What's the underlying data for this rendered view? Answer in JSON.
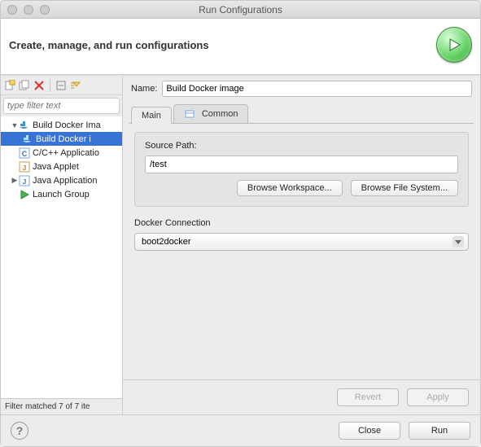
{
  "window": {
    "title": "Run Configurations"
  },
  "header": {
    "title": "Create, manage, and run configurations"
  },
  "filter": {
    "placeholder": "type filter text"
  },
  "tree": {
    "items": [
      {
        "label": "Build Docker Ima"
      },
      {
        "label": "Build Docker i"
      },
      {
        "label": "C/C++ Applicatio"
      },
      {
        "label": "Java Applet"
      },
      {
        "label": "Java Application"
      },
      {
        "label": "Launch Group"
      }
    ],
    "status": "Filter matched 7 of 7 ite"
  },
  "form": {
    "name_label": "Name:",
    "name_value": "Build Docker image",
    "tabs": {
      "main": "Main",
      "common": "Common"
    },
    "source_path_label": "Source Path:",
    "source_path_value": "/test",
    "browse_workspace": "Browse Workspace...",
    "browse_filesystem": "Browse File System...",
    "docker_connection_label": "Docker Connection",
    "docker_connection_value": "boot2docker",
    "revert": "Revert",
    "apply": "Apply"
  },
  "footer": {
    "close": "Close",
    "run": "Run"
  }
}
